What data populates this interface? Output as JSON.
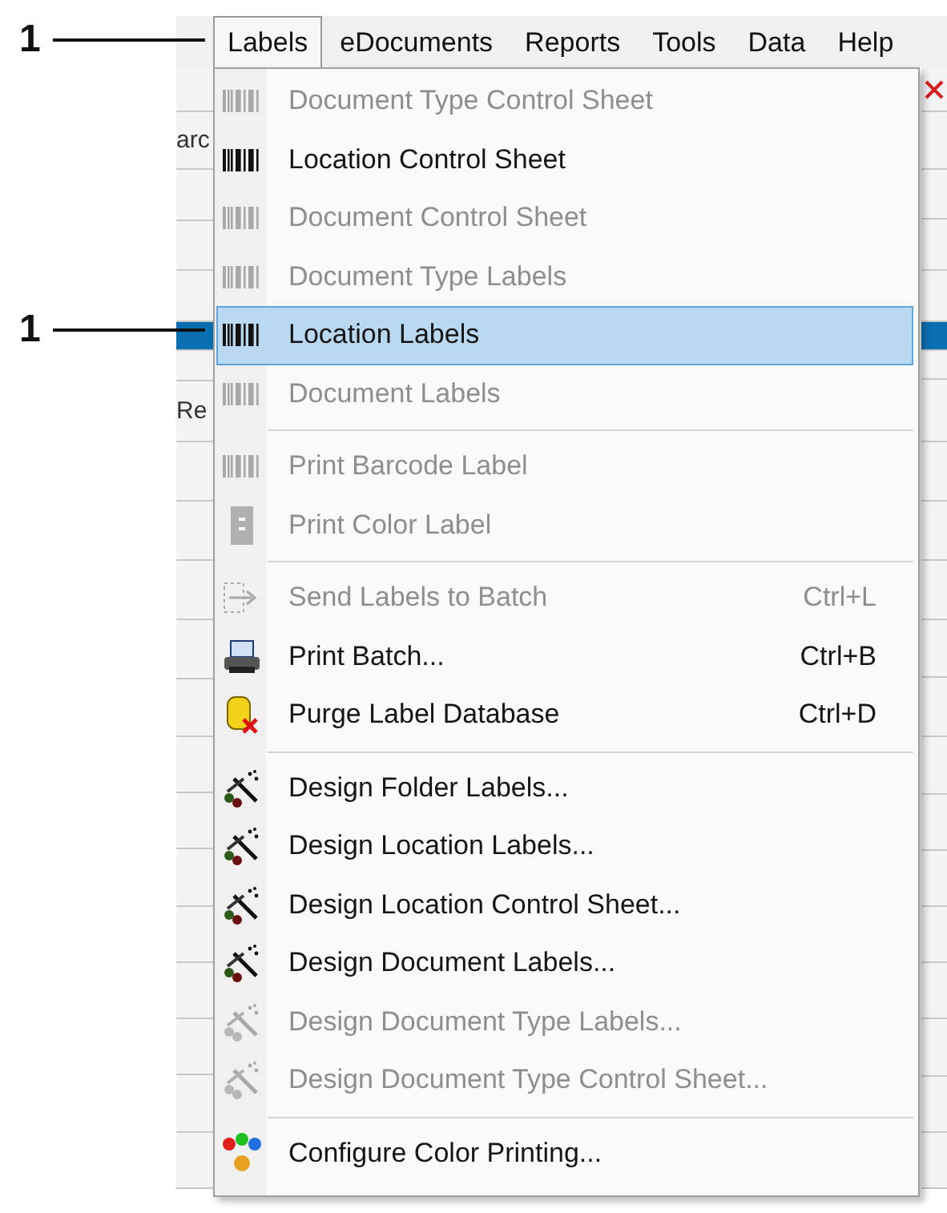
{
  "callouts": [
    {
      "label": "1"
    },
    {
      "label": "1"
    }
  ],
  "menubar": [
    {
      "label": "Labels",
      "selected": true
    },
    {
      "label": "eDocuments",
      "selected": false
    },
    {
      "label": "Reports",
      "selected": false
    },
    {
      "label": "Tools",
      "selected": false
    },
    {
      "label": "Data",
      "selected": false
    },
    {
      "label": "Help",
      "selected": false
    }
  ],
  "background": {
    "left_fragments": [
      "arc",
      "Re"
    ]
  },
  "menu": [
    {
      "kind": "barcode",
      "label": "Document Type Control Sheet",
      "disabled": true,
      "selected": false
    },
    {
      "kind": "barcode",
      "label": "Location Control Sheet",
      "disabled": false,
      "selected": false
    },
    {
      "kind": "barcode",
      "label": "Document Control Sheet",
      "disabled": true,
      "selected": false
    },
    {
      "kind": "barcode",
      "label": "Document Type Labels",
      "disabled": true,
      "selected": false
    },
    {
      "kind": "barcode",
      "label": "Location Labels",
      "disabled": false,
      "selected": true
    },
    {
      "kind": "barcode",
      "label": "Document Labels",
      "disabled": true,
      "selected": false
    },
    {
      "kind": "separator"
    },
    {
      "kind": "barcode",
      "label": "Print Barcode Label",
      "disabled": true,
      "selected": false
    },
    {
      "kind": "color-label",
      "label": "Print Color Label",
      "disabled": true,
      "selected": false
    },
    {
      "kind": "separator"
    },
    {
      "kind": "send",
      "label": "Send Labels to Batch",
      "shortcut": "Ctrl+L",
      "disabled": true,
      "selected": false
    },
    {
      "kind": "printer",
      "label": "Print Batch...",
      "shortcut": "Ctrl+B",
      "disabled": false,
      "selected": false
    },
    {
      "kind": "purge",
      "label": "Purge Label Database",
      "shortcut": "Ctrl+D",
      "disabled": false,
      "selected": false
    },
    {
      "kind": "separator"
    },
    {
      "kind": "wand",
      "label": "Design Folder Labels...",
      "disabled": false,
      "selected": false
    },
    {
      "kind": "wand",
      "label": "Design Location Labels...",
      "disabled": false,
      "selected": false
    },
    {
      "kind": "wand",
      "label": "Design Location Control Sheet...",
      "disabled": false,
      "selected": false
    },
    {
      "kind": "wand",
      "label": "Design Document Labels...",
      "disabled": false,
      "selected": false
    },
    {
      "kind": "wand",
      "label": "Design Document Type Labels...",
      "disabled": true,
      "selected": false
    },
    {
      "kind": "wand",
      "label": "Design Document Type Control Sheet...",
      "disabled": true,
      "selected": false
    },
    {
      "kind": "separator"
    },
    {
      "kind": "palette",
      "label": "Configure Color Printing...",
      "disabled": false,
      "selected": false
    }
  ]
}
